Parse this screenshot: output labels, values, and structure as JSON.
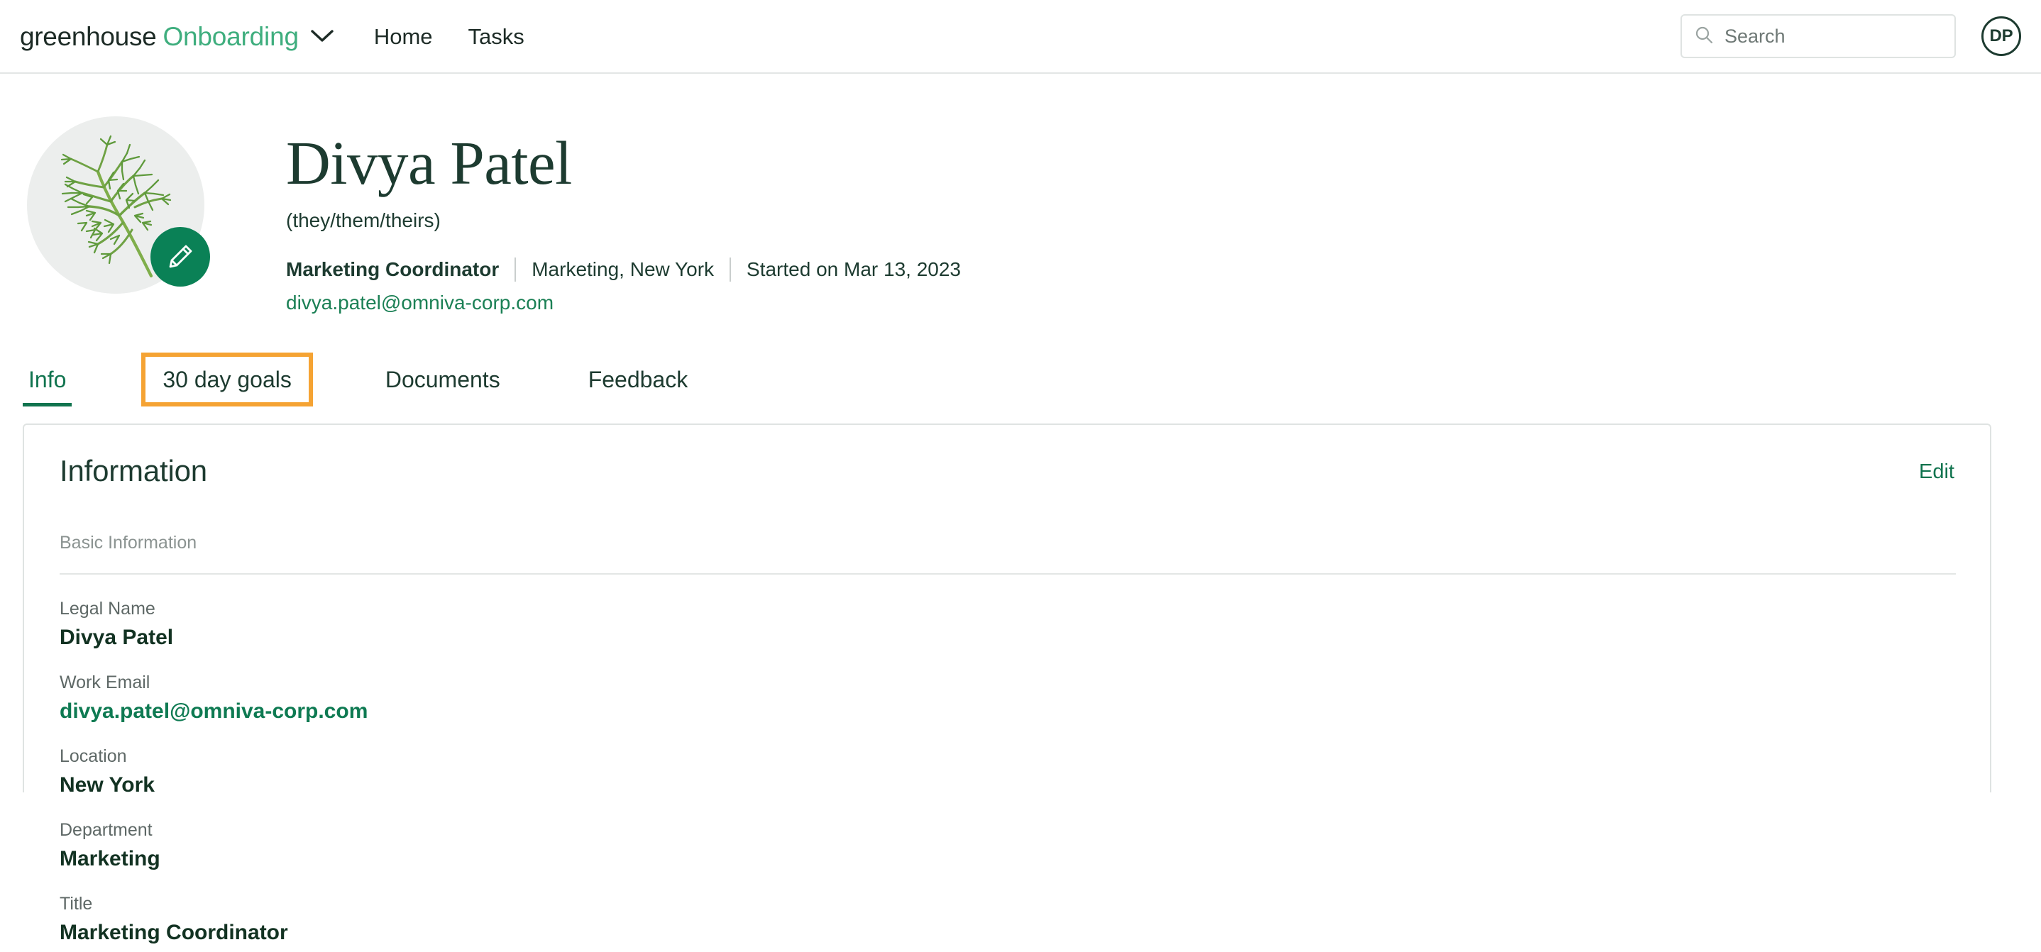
{
  "topbar": {
    "brand_primary": "greenhouse",
    "brand_secondary": "Onboarding",
    "chevron_icon": "chevron-down-icon",
    "nav": [
      {
        "label": "Home"
      },
      {
        "label": "Tasks"
      }
    ],
    "search": {
      "icon": "search-icon",
      "placeholder": "Search",
      "value": ""
    },
    "user_initials": "DP"
  },
  "profile": {
    "avatar": {
      "alt": "dill-sprig-avatar",
      "edit_icon": "pencil-icon",
      "background_color": "#eceeed"
    },
    "name": "Divya Patel",
    "pronouns": "(they/them/theirs)",
    "title": "Marketing Coordinator",
    "department_location": "Marketing, New York",
    "start_date": "Started on Mar 13, 2023",
    "email": "divya.patel@omniva-corp.com"
  },
  "tabs": {
    "items": [
      {
        "label": "Info",
        "active": true,
        "highlighted": false
      },
      {
        "label": "30 day goals",
        "active": false,
        "highlighted": true
      },
      {
        "label": "Documents",
        "active": false,
        "highlighted": false
      },
      {
        "label": "Feedback",
        "active": false,
        "highlighted": false
      }
    ],
    "highlight_color": "#f5a333",
    "active_color": "#11744f"
  },
  "information_card": {
    "title": "Information",
    "edit_label": "Edit",
    "section_label": "Basic Information",
    "fields": [
      {
        "label": "Legal Name",
        "value": "Divya Patel",
        "is_link": false
      },
      {
        "label": "Work Email",
        "value": "divya.patel@omniva-corp.com",
        "is_link": true
      },
      {
        "label": "Location",
        "value": "New York",
        "is_link": false
      },
      {
        "label": "Department",
        "value": "Marketing",
        "is_link": false
      },
      {
        "label": "Title",
        "value": "Marketing Coordinator",
        "is_link": false
      }
    ]
  },
  "colors": {
    "brand_green": "#3fae7e",
    "dark_green": "#1d3b30",
    "link_green": "#0e7a52",
    "accent_orange": "#f5a333",
    "border_gray": "#dfe3e2"
  }
}
